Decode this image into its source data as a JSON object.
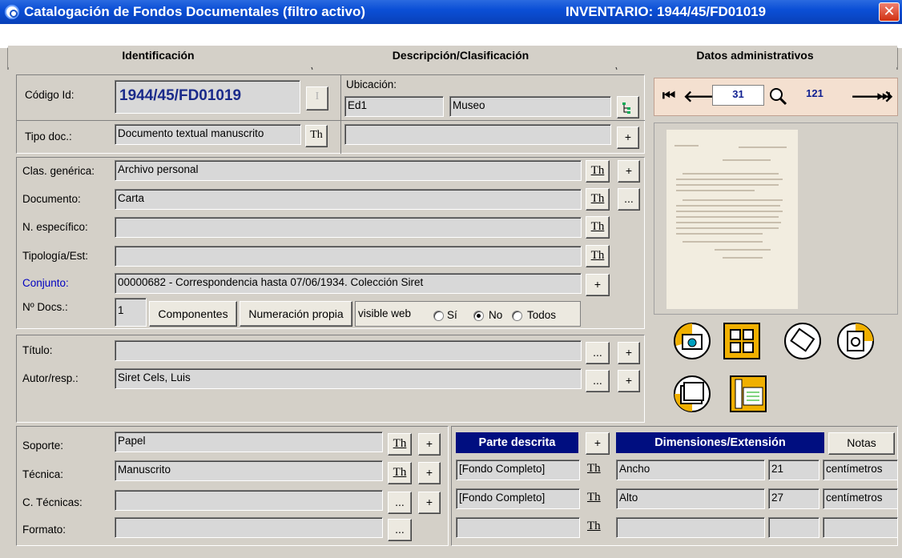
{
  "window": {
    "title": "Catalogación de Fondos Documentales (filtro activo)",
    "inventory": "INVENTARIO: 1944/45/FD01019",
    "close": "✕"
  },
  "tabs": [
    {
      "label": "Identificación"
    },
    {
      "label": "Descripción/Clasificación"
    },
    {
      "label": "Datos administrativos"
    }
  ],
  "ident": {
    "codigo_label": "Código Id:",
    "codigo_value": "1944/45/FD01019",
    "i_btn": "I",
    "ubicacion_label": "Ubicación:",
    "ubic1": "Ed1",
    "ubic2": "Museo",
    "tipo_label": "Tipo doc.:",
    "tipo_value": "Documento textual manuscrito",
    "th": "Th",
    "plus": "+",
    "dots": "..."
  },
  "classif": {
    "clas_label": "Clas. genérica:",
    "clas_value": "Archivo personal",
    "doc_label": "Documento:",
    "doc_value": "Carta",
    "nesp_label": "N. específico:",
    "nesp_value": "",
    "tipologia_label": "Tipología/Est:",
    "tipologia_value": "",
    "conjunto_label": "Conjunto:",
    "conjunto_value": "00000682 - Correspondencia hasta 07/06/1934. Colección Siret",
    "ndocs_label": "Nº Docs.:",
    "ndocs_value": "1",
    "componentes": "Componentes",
    "numeracion": "Numeración propia",
    "visible_web": "visible web",
    "opt_si": "Sí",
    "opt_no": "No",
    "opt_todos": "Todos",
    "selected": "No"
  },
  "titulo": {
    "titulo_label": "Título:",
    "titulo_value": "",
    "autor_label": "Autor/resp.:",
    "autor_value": "Siret Cels, Luis"
  },
  "soporte": {
    "soporte_label": "Soporte:",
    "soporte_value": "Papel",
    "tecnica_label": "Técnica:",
    "tecnica_value": "Manuscrito",
    "ctec_label": "C. Técnicas:",
    "ctec_value": "",
    "formato_label": "Formato:",
    "formato_value": ""
  },
  "parte": {
    "header": "Parte descrita",
    "rows": [
      "[Fondo Completo]",
      "[Fondo Completo]",
      ""
    ]
  },
  "dimensiones": {
    "header": "Dimensiones/Extensión",
    "notas": "Notas",
    "rows": [
      {
        "name": "Ancho",
        "value": "21",
        "unit": "centímetros"
      },
      {
        "name": "Alto",
        "value": "27",
        "unit": "centímetros"
      },
      {
        "name": "",
        "value": "",
        "unit": ""
      }
    ]
  },
  "nav": {
    "current": "31",
    "total": "121"
  },
  "colors": {
    "title_blue": "#0b4fd6",
    "header_navy": "#000e80",
    "code_blue": "#1a2a8a",
    "link_blue": "#0000c0",
    "icon_yellow": "#f0b000"
  }
}
